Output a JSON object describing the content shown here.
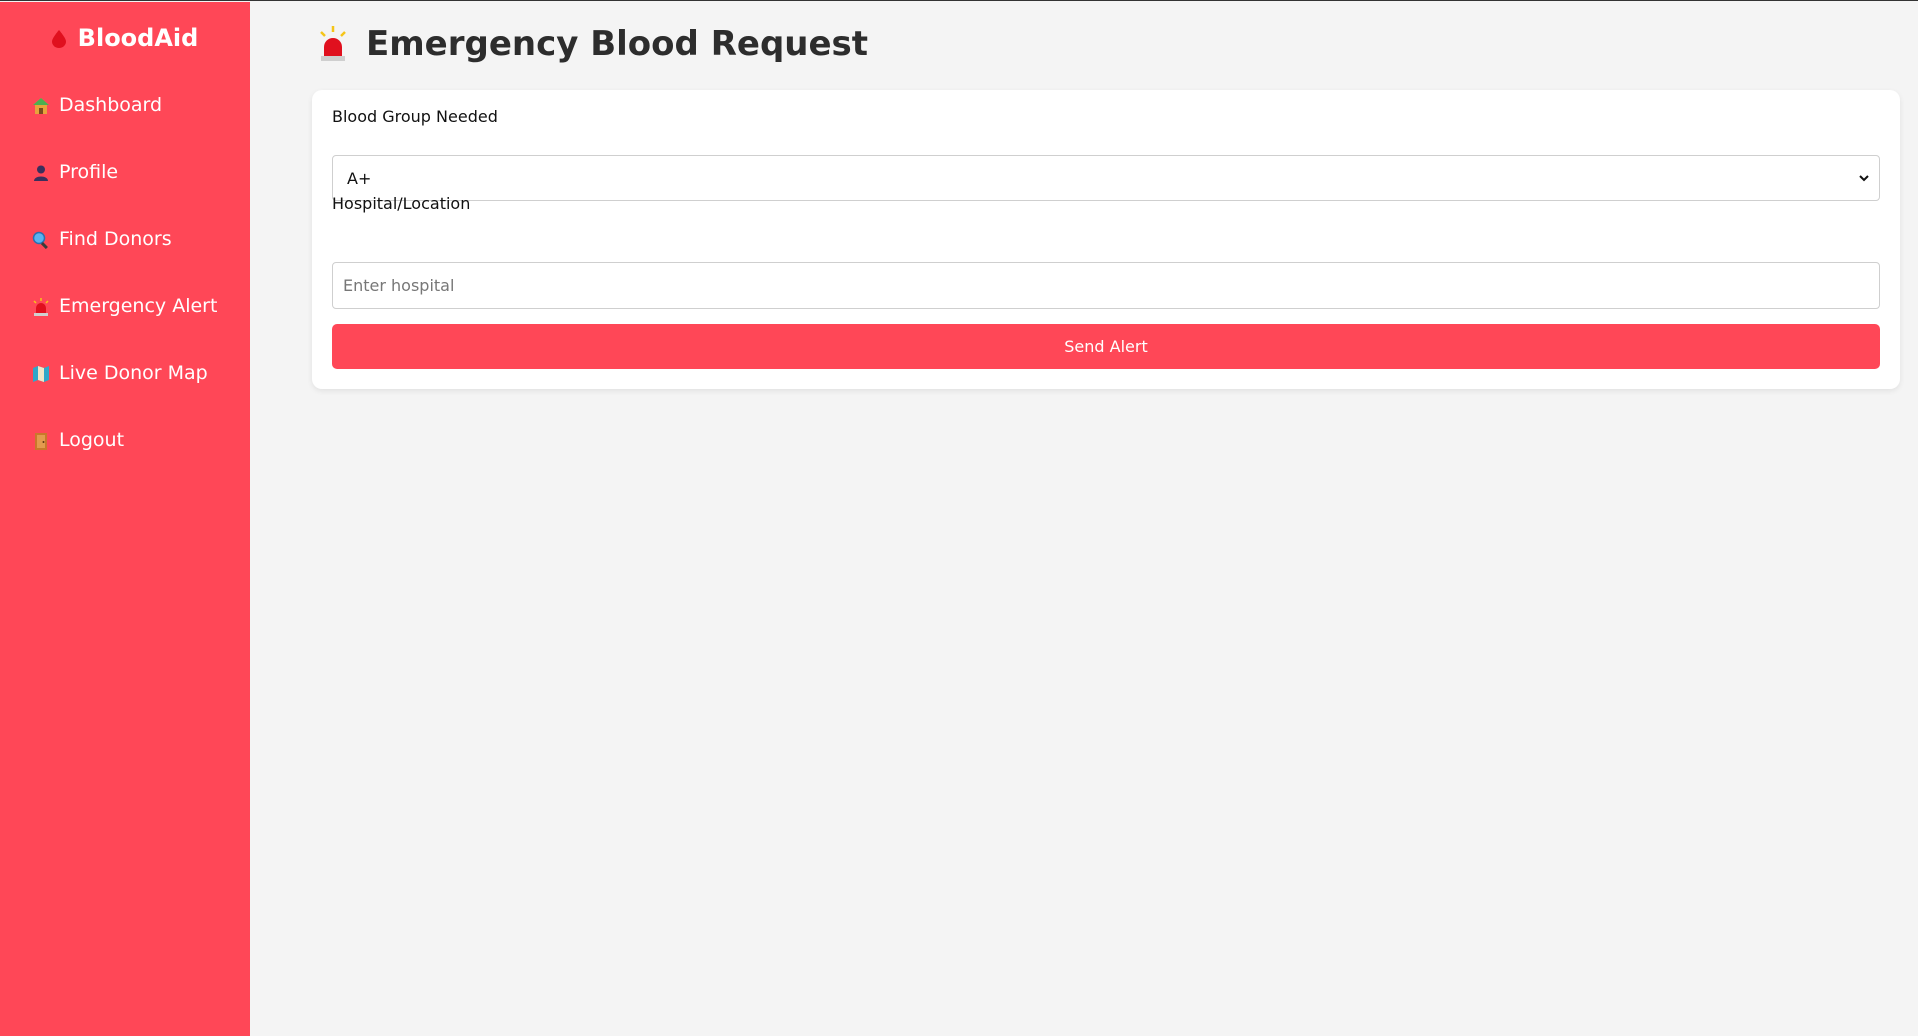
{
  "sidebar": {
    "brand": "BloodAid",
    "items": [
      {
        "label": "Dashboard",
        "icon": "house-icon"
      },
      {
        "label": "Profile",
        "icon": "user-icon"
      },
      {
        "label": "Find Donors",
        "icon": "magnifier-icon"
      },
      {
        "label": "Emergency Alert",
        "icon": "siren-icon"
      },
      {
        "label": "Live Donor Map",
        "icon": "map-icon"
      },
      {
        "label": "Logout",
        "icon": "door-icon"
      }
    ]
  },
  "main": {
    "title": "Emergency Blood Request",
    "form": {
      "blood_group_label": "Blood Group Needed",
      "blood_group_value": "A+",
      "location_label": "Hospital/Location",
      "location_placeholder": "Enter hospital",
      "submit_label": "Send Alert"
    }
  },
  "colors": {
    "primary": "#ff4757",
    "background": "#f4f4f4",
    "card": "#ffffff"
  }
}
